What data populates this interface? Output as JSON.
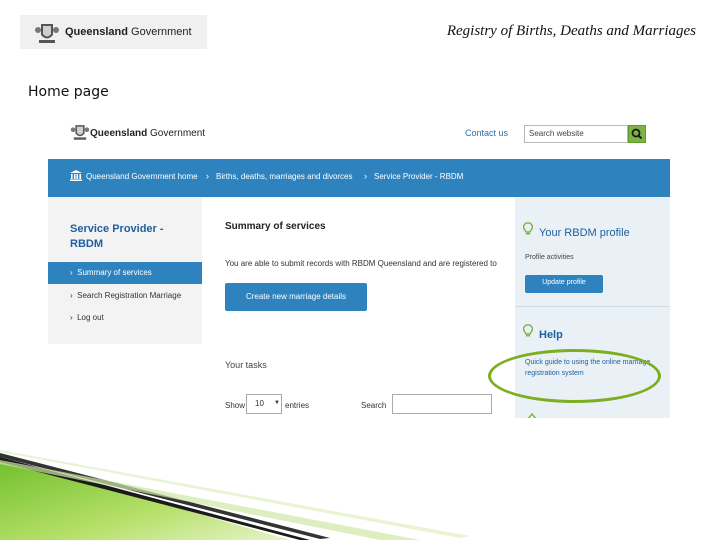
{
  "slide": {
    "logo_bold": "Queensland",
    "logo_rest": "Government",
    "title": "Registry of Births, Deaths and Marriages",
    "subtitle": "Home page"
  },
  "site": {
    "logo_bold": "Queensland",
    "logo_rest": "Government",
    "contact_link": "Contact us",
    "search_placeholder": "Search website"
  },
  "breadcrumb": [
    {
      "label": "Queensland Government home"
    },
    {
      "label": "Births, deaths, marriages and divorces"
    },
    {
      "label": "Service Provider - RBDM"
    }
  ],
  "sidebar": {
    "title": "Service Provider - RBDM",
    "items": [
      {
        "label": "Summary of services"
      },
      {
        "label": "Search Registration   Marriage"
      },
      {
        "label": "Log out"
      }
    ]
  },
  "main": {
    "heading": "Summary of services",
    "intro": "You are able to submit records with RBDM Queensland and are registered to",
    "create_button": "Create new marriage details",
    "tasks_label": "Your tasks",
    "show_label": "Show",
    "entries_value": "10",
    "entries_label": "entries",
    "search_label": "Search"
  },
  "right_panel": {
    "profile_title": "Your RBDM profile",
    "profile_activities": "Profile activities",
    "update_button": "Update profile",
    "help_title": "Help",
    "help_link_line1": "Quick guide to using the online marriage",
    "help_link_line2": "registration system"
  },
  "colors": {
    "nav_blue": "#2e83bf",
    "title_blue": "#1f5fa0",
    "search_green": "#7cb342",
    "highlight_green": "#7cae1f"
  }
}
